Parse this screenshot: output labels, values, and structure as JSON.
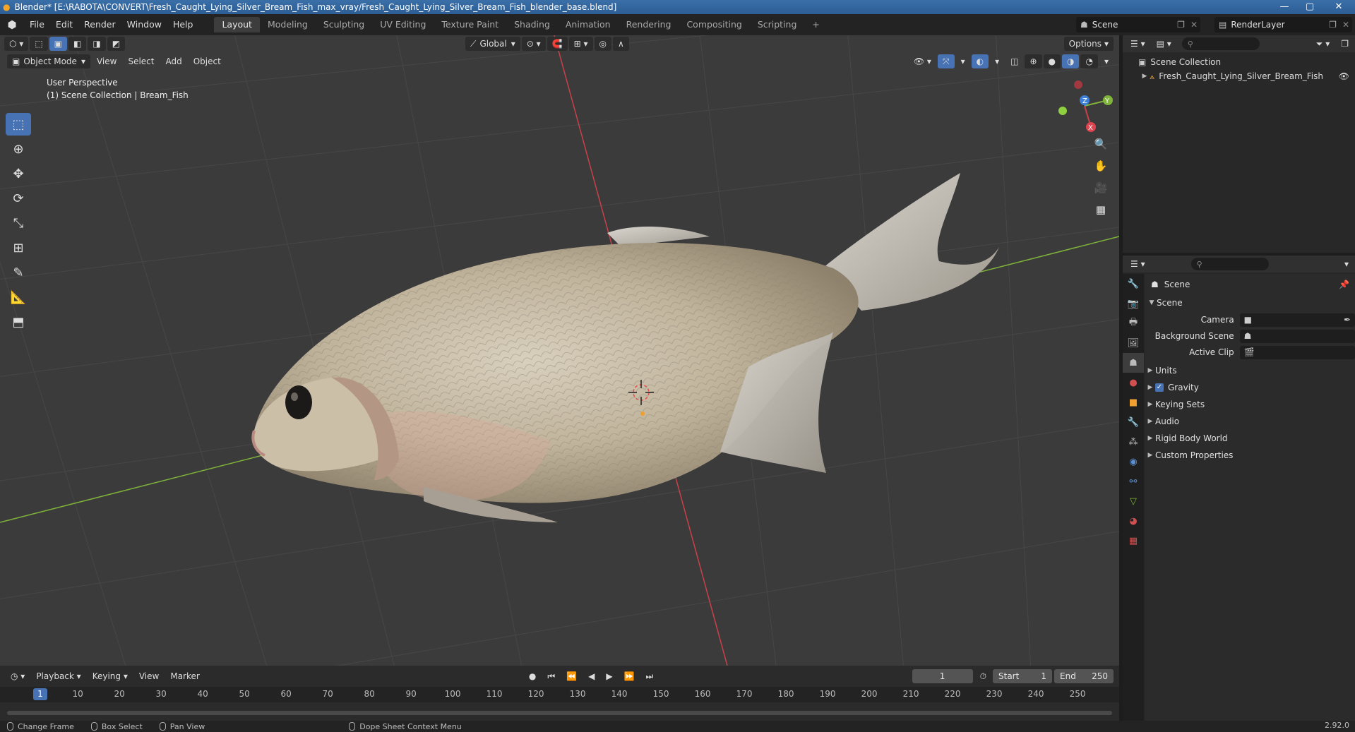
{
  "titlebar": {
    "title": "Blender* [E:\\RABOTA\\CONVERT\\Fresh_Caught_Lying_Silver_Bream_Fish_max_vray/Fresh_Caught_Lying_Silver_Bream_Fish_blender_base.blend]",
    "minimize": "—",
    "maximize": "▢",
    "close": "✕"
  },
  "menu": {
    "items": [
      "File",
      "Edit",
      "Render",
      "Window",
      "Help"
    ]
  },
  "workspaces": [
    "Layout",
    "Modeling",
    "Sculpting",
    "UV Editing",
    "Texture Paint",
    "Shading",
    "Animation",
    "Rendering",
    "Compositing",
    "Scripting"
  ],
  "topright": {
    "scene": "Scene",
    "render_layer": "RenderLayer"
  },
  "viewport": {
    "mode": "Object Mode",
    "menus": [
      "View",
      "Select",
      "Add",
      "Object"
    ],
    "transform_orientation": "Global",
    "options": "Options",
    "info_line1": "User Perspective",
    "info_line2": "(1) Scene Collection | Bream_Fish",
    "axis_colors": {
      "x": "#c9414a",
      "y": "#7fb33a",
      "z": "#3d7fd9"
    }
  },
  "timeline": {
    "menus": [
      "Playback",
      "Keying",
      "View",
      "Marker"
    ],
    "current_frame": "1",
    "start_label": "Start",
    "start_value": "1",
    "end_label": "End",
    "end_value": "250",
    "ticks": [
      "10",
      "20",
      "30",
      "40",
      "50",
      "60",
      "70",
      "80",
      "90",
      "100",
      "110",
      "120",
      "130",
      "140",
      "150",
      "160",
      "170",
      "180",
      "190",
      "200",
      "210",
      "220",
      "230",
      "240",
      "250"
    ],
    "ruler_current": "1"
  },
  "statusbar": {
    "change_frame": "Change Frame",
    "box_select": "Box Select",
    "pan_view": "Pan View",
    "context_menu": "Dope Sheet Context Menu",
    "version": "2.92.0"
  },
  "outliner": {
    "collection": "Scene Collection",
    "object": "Fresh_Caught_Lying_Silver_Bream_Fish"
  },
  "properties": {
    "context": "Scene",
    "section_scene": "Scene",
    "camera_label": "Camera",
    "background_scene_label": "Background Scene",
    "active_clip_label": "Active Clip",
    "subpanels": [
      "Units",
      "Gravity",
      "Keying Sets",
      "Audio",
      "Rigid Body World",
      "Custom Properties"
    ]
  }
}
